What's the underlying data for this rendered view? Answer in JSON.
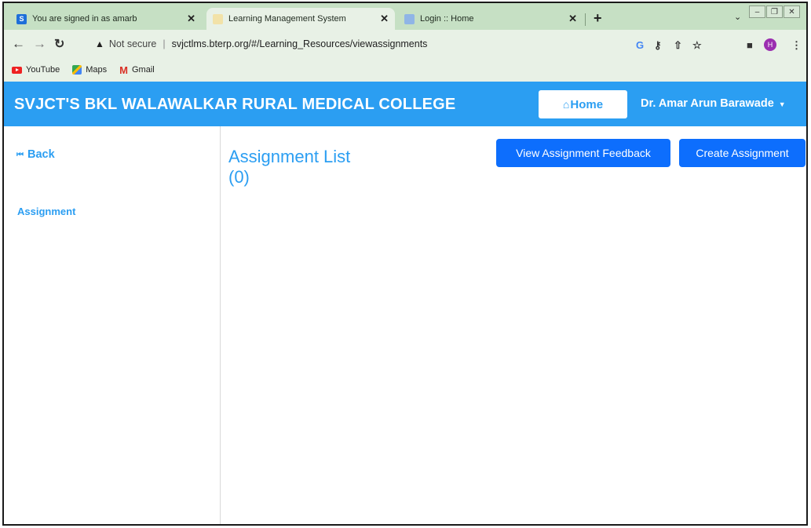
{
  "browser": {
    "tabs": [
      {
        "title": "You are signed in as amarb",
        "favicon": "S"
      },
      {
        "title": "Learning Management System",
        "favicon": ""
      },
      {
        "title": "Login :: Home",
        "favicon": ""
      }
    ],
    "url_security": "Not secure",
    "url": "svjctlms.bterp.org/#/Learning_Resources/viewassignments",
    "profile_initial": "H",
    "bookmarks": [
      {
        "label": "YouTube",
        "icon": "youtube-icon"
      },
      {
        "label": "Maps",
        "icon": "maps-icon"
      },
      {
        "label": "Gmail",
        "icon": "gmail-icon"
      }
    ]
  },
  "app": {
    "title": "SVJCT'S BKL WALAWALKAR RURAL MEDICAL COLLEGE",
    "home_label": "Home",
    "user_name": "Dr. Amar Arun Barawade"
  },
  "sidebar": {
    "back_label": "Back",
    "items": [
      {
        "label": "Assignment"
      }
    ]
  },
  "main": {
    "heading": "Assignment List",
    "count": "(0)",
    "feedback_button": "View Assignment Feedback",
    "create_button": "Create Assignment"
  },
  "colors": {
    "accent": "#2b9ef2",
    "button": "#0d6efd",
    "chrome": "#c6e0c4"
  }
}
